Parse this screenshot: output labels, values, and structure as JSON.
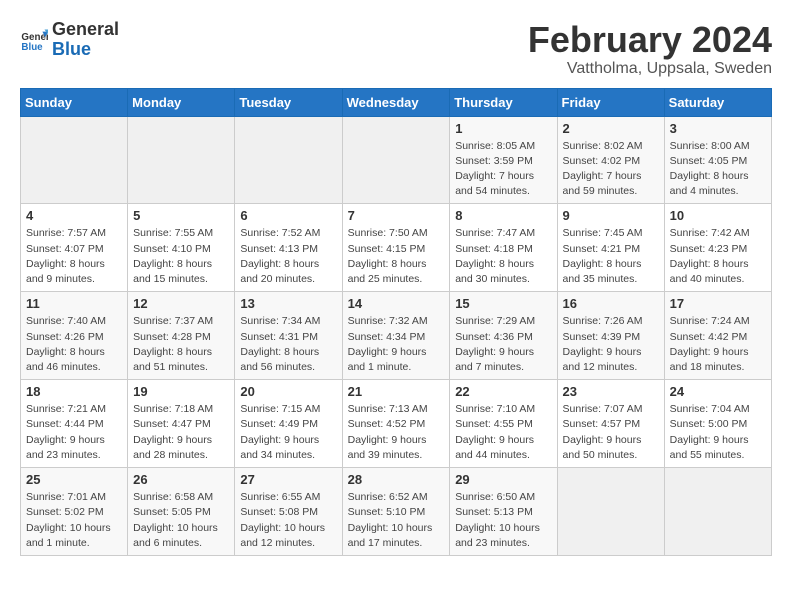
{
  "header": {
    "logo_general": "General",
    "logo_blue": "Blue",
    "month_title": "February 2024",
    "location": "Vattholma, Uppsala, Sweden"
  },
  "weekdays": [
    "Sunday",
    "Monday",
    "Tuesday",
    "Wednesday",
    "Thursday",
    "Friday",
    "Saturday"
  ],
  "weeks": [
    [
      {
        "day": "",
        "info": ""
      },
      {
        "day": "",
        "info": ""
      },
      {
        "day": "",
        "info": ""
      },
      {
        "day": "",
        "info": ""
      },
      {
        "day": "1",
        "info": "Sunrise: 8:05 AM\nSunset: 3:59 PM\nDaylight: 7 hours\nand 54 minutes."
      },
      {
        "day": "2",
        "info": "Sunrise: 8:02 AM\nSunset: 4:02 PM\nDaylight: 7 hours\nand 59 minutes."
      },
      {
        "day": "3",
        "info": "Sunrise: 8:00 AM\nSunset: 4:05 PM\nDaylight: 8 hours\nand 4 minutes."
      }
    ],
    [
      {
        "day": "4",
        "info": "Sunrise: 7:57 AM\nSunset: 4:07 PM\nDaylight: 8 hours\nand 9 minutes."
      },
      {
        "day": "5",
        "info": "Sunrise: 7:55 AM\nSunset: 4:10 PM\nDaylight: 8 hours\nand 15 minutes."
      },
      {
        "day": "6",
        "info": "Sunrise: 7:52 AM\nSunset: 4:13 PM\nDaylight: 8 hours\nand 20 minutes."
      },
      {
        "day": "7",
        "info": "Sunrise: 7:50 AM\nSunset: 4:15 PM\nDaylight: 8 hours\nand 25 minutes."
      },
      {
        "day": "8",
        "info": "Sunrise: 7:47 AM\nSunset: 4:18 PM\nDaylight: 8 hours\nand 30 minutes."
      },
      {
        "day": "9",
        "info": "Sunrise: 7:45 AM\nSunset: 4:21 PM\nDaylight: 8 hours\nand 35 minutes."
      },
      {
        "day": "10",
        "info": "Sunrise: 7:42 AM\nSunset: 4:23 PM\nDaylight: 8 hours\nand 40 minutes."
      }
    ],
    [
      {
        "day": "11",
        "info": "Sunrise: 7:40 AM\nSunset: 4:26 PM\nDaylight: 8 hours\nand 46 minutes."
      },
      {
        "day": "12",
        "info": "Sunrise: 7:37 AM\nSunset: 4:28 PM\nDaylight: 8 hours\nand 51 minutes."
      },
      {
        "day": "13",
        "info": "Sunrise: 7:34 AM\nSunset: 4:31 PM\nDaylight: 8 hours\nand 56 minutes."
      },
      {
        "day": "14",
        "info": "Sunrise: 7:32 AM\nSunset: 4:34 PM\nDaylight: 9 hours\nand 1 minute."
      },
      {
        "day": "15",
        "info": "Sunrise: 7:29 AM\nSunset: 4:36 PM\nDaylight: 9 hours\nand 7 minutes."
      },
      {
        "day": "16",
        "info": "Sunrise: 7:26 AM\nSunset: 4:39 PM\nDaylight: 9 hours\nand 12 minutes."
      },
      {
        "day": "17",
        "info": "Sunrise: 7:24 AM\nSunset: 4:42 PM\nDaylight: 9 hours\nand 18 minutes."
      }
    ],
    [
      {
        "day": "18",
        "info": "Sunrise: 7:21 AM\nSunset: 4:44 PM\nDaylight: 9 hours\nand 23 minutes."
      },
      {
        "day": "19",
        "info": "Sunrise: 7:18 AM\nSunset: 4:47 PM\nDaylight: 9 hours\nand 28 minutes."
      },
      {
        "day": "20",
        "info": "Sunrise: 7:15 AM\nSunset: 4:49 PM\nDaylight: 9 hours\nand 34 minutes."
      },
      {
        "day": "21",
        "info": "Sunrise: 7:13 AM\nSunset: 4:52 PM\nDaylight: 9 hours\nand 39 minutes."
      },
      {
        "day": "22",
        "info": "Sunrise: 7:10 AM\nSunset: 4:55 PM\nDaylight: 9 hours\nand 44 minutes."
      },
      {
        "day": "23",
        "info": "Sunrise: 7:07 AM\nSunset: 4:57 PM\nDaylight: 9 hours\nand 50 minutes."
      },
      {
        "day": "24",
        "info": "Sunrise: 7:04 AM\nSunset: 5:00 PM\nDaylight: 9 hours\nand 55 minutes."
      }
    ],
    [
      {
        "day": "25",
        "info": "Sunrise: 7:01 AM\nSunset: 5:02 PM\nDaylight: 10 hours\nand 1 minute."
      },
      {
        "day": "26",
        "info": "Sunrise: 6:58 AM\nSunset: 5:05 PM\nDaylight: 10 hours\nand 6 minutes."
      },
      {
        "day": "27",
        "info": "Sunrise: 6:55 AM\nSunset: 5:08 PM\nDaylight: 10 hours\nand 12 minutes."
      },
      {
        "day": "28",
        "info": "Sunrise: 6:52 AM\nSunset: 5:10 PM\nDaylight: 10 hours\nand 17 minutes."
      },
      {
        "day": "29",
        "info": "Sunrise: 6:50 AM\nSunset: 5:13 PM\nDaylight: 10 hours\nand 23 minutes."
      },
      {
        "day": "",
        "info": ""
      },
      {
        "day": "",
        "info": ""
      }
    ]
  ]
}
